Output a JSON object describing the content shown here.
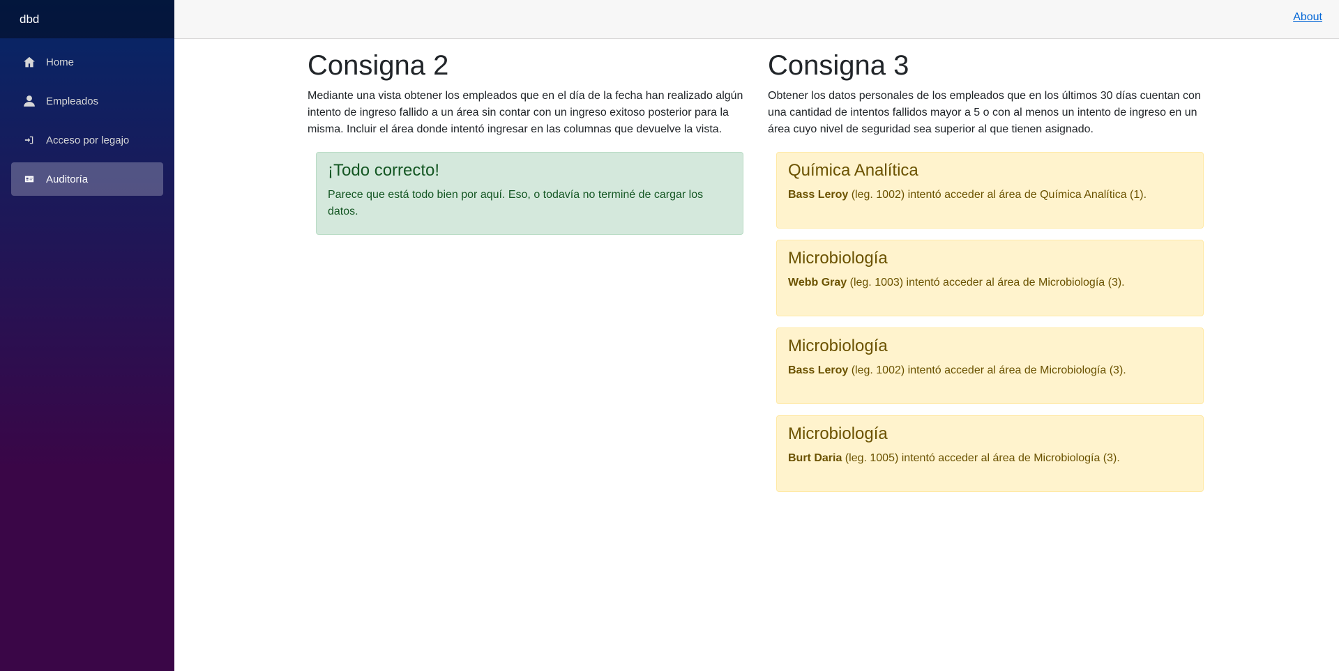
{
  "brand": "dbd",
  "nav": [
    {
      "label": "Home",
      "icon": "home-icon"
    },
    {
      "label": "Empleados",
      "icon": "person-icon"
    },
    {
      "label": "Acceso por legajo",
      "icon": "sign-in-icon"
    },
    {
      "label": "Auditoría",
      "icon": "id-card-icon",
      "active": true
    }
  ],
  "topbar": {
    "about": "About"
  },
  "consigna2": {
    "title": "Consigna 2",
    "description": "Mediante una vista obtener los empleados que en el día de la fecha han realizado algún intento de ingreso fallido a un área sin contar con un ingreso exitoso posterior para la misma. Incluir el área donde intentó ingresar en las columnas que devuelve la vista.",
    "alert": {
      "heading": "¡Todo correcto!",
      "text": "Parece que está todo bien por aquí. Eso, o todavía no terminé de cargar los datos."
    }
  },
  "consigna3": {
    "title": "Consigna 3",
    "description": "Obtener los datos personales de los empleados que en los últimos 30 días cuentan con una cantidad de intentos fallidos mayor a 5 o con al menos un intento de ingreso en un área cuyo nivel de seguridad sea superior al que tienen asignado.",
    "items": [
      {
        "area": "Química Analítica",
        "name": "Bass Leroy",
        "rest": " (leg. 1002) intentó acceder al área de Química Analítica (1)."
      },
      {
        "area": "Microbiología",
        "name": "Webb Gray",
        "rest": " (leg. 1003) intentó acceder al área de Microbiología (3)."
      },
      {
        "area": "Microbiología",
        "name": "Bass Leroy",
        "rest": " (leg. 1002) intentó acceder al área de Microbiología (3)."
      },
      {
        "area": "Microbiología",
        "name": "Burt Daria",
        "rest": " (leg. 1005) intentó acceder al área de Microbiología (3)."
      }
    ]
  }
}
